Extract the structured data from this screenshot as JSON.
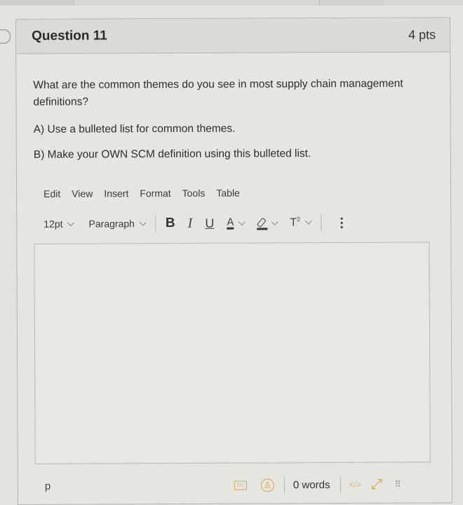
{
  "question": {
    "title": "Question 11",
    "points": "4 pts",
    "prompt": "What are the common themes do you see in most supply chain management definitions?",
    "instructions": [
      "A) Use a bulleted list for common themes.",
      "B) Make your OWN SCM definition using this bulleted list."
    ]
  },
  "editor": {
    "menu": [
      "Edit",
      "View",
      "Insert",
      "Format",
      "Tools",
      "Table"
    ],
    "toolbar": {
      "font_size": "12pt",
      "block_format": "Paragraph",
      "bold": "B",
      "italic": "I",
      "underline": "U",
      "text_color": "A",
      "superscript": "T",
      "superscript_mark": "2",
      "more": "⋮"
    },
    "content": "",
    "status": {
      "path": "p",
      "word_count": "0 words",
      "html_editor": "</>",
      "fullscreen": "⤢",
      "resize": "⠿"
    },
    "icons": {
      "keyboard": "keyboard-icon",
      "accessibility": "accessibility-icon"
    }
  },
  "colors": {
    "accent_icon": "#c9a84a",
    "background": "#e4e2dd",
    "header_bg": "#dcdad5"
  }
}
